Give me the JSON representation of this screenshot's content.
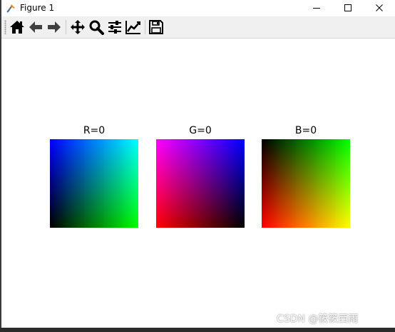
{
  "window": {
    "title": "Figure 1"
  },
  "toolbar": {
    "buttons": [
      {
        "icon": "home-icon"
      },
      {
        "icon": "back-arrow-icon"
      },
      {
        "icon": "forward-arrow-icon"
      },
      {
        "icon": "pan-move-icon"
      },
      {
        "icon": "zoom-magnifier-icon"
      },
      {
        "icon": "configure-subplots-icon"
      },
      {
        "icon": "edit-axis-lines-icon"
      },
      {
        "icon": "save-floppy-icon"
      }
    ]
  },
  "figure": {
    "panels": [
      {
        "title": "R=0"
      },
      {
        "title": "G=0"
      },
      {
        "title": "B=0"
      }
    ]
  },
  "chart_data": [
    {
      "type": "heatmap",
      "title": "R=0",
      "fixed_channel": "R",
      "fixed_value": 0,
      "corners": {
        "top-left": "#0000ff",
        "top-right": "#00ffff",
        "bottom-left": "#000000",
        "bottom-right": "#00ff00"
      }
    },
    {
      "type": "heatmap",
      "title": "G=0",
      "fixed_channel": "G",
      "fixed_value": 0,
      "corners": {
        "top-left": "#ff00ff",
        "top-right": "#0000ff",
        "bottom-left": "#ff0000",
        "bottom-right": "#000000"
      }
    },
    {
      "type": "heatmap",
      "title": "B=0",
      "fixed_channel": "B",
      "fixed_value": 0,
      "corners": {
        "top-left": "#000000",
        "top-right": "#00ff00",
        "bottom-left": "#ff0000",
        "bottom-right": "#ffff00"
      }
    }
  ],
  "watermark": "CSDN @筱筱西雨"
}
